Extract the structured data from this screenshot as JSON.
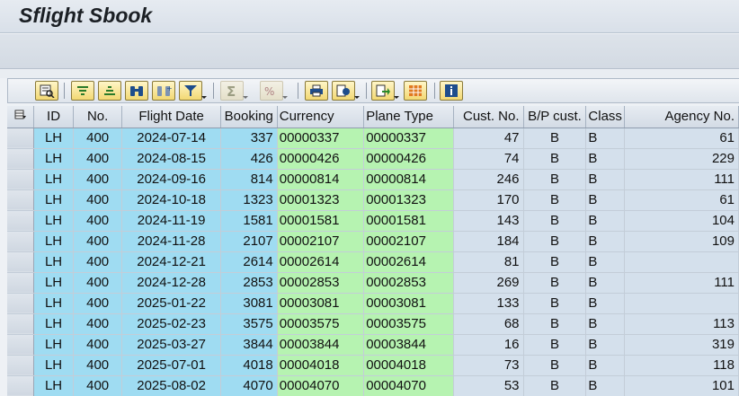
{
  "window": {
    "title": "Sflight Sbook"
  },
  "toolbar": {
    "buttons": [
      {
        "name": "details-button",
        "icon": "details-icon"
      },
      {
        "name": "sort-ascending-button",
        "icon": "sort-ascending-icon"
      },
      {
        "name": "sort-descending-button",
        "icon": "sort-descending-icon"
      },
      {
        "name": "find-button",
        "icon": "binoculars-icon"
      },
      {
        "name": "find-next-button",
        "icon": "find-next-icon"
      },
      {
        "name": "filter-button",
        "icon": "filter-icon"
      },
      {
        "name": "total-button",
        "icon": "sigma-icon"
      },
      {
        "name": "subtotal-button",
        "icon": "subtotal-icon"
      },
      {
        "name": "print-button",
        "icon": "printer-icon"
      },
      {
        "name": "views-button",
        "icon": "views-icon"
      },
      {
        "name": "export-button",
        "icon": "export-icon"
      },
      {
        "name": "layout-button",
        "icon": "layout-grid-icon"
      },
      {
        "name": "info-button",
        "icon": "info-icon"
      }
    ]
  },
  "grid": {
    "columns": [
      "ID",
      "No.",
      "Flight Date",
      "Booking",
      "Currency",
      "Plane Type",
      "Cust. No.",
      "B/P cust.",
      "Class",
      "Agency No."
    ],
    "rows": [
      [
        "LH",
        "400",
        "2024-07-14",
        "337",
        "00000337",
        "00000337",
        "47",
        "B",
        "B",
        "61"
      ],
      [
        "LH",
        "400",
        "2024-08-15",
        "426",
        "00000426",
        "00000426",
        "74",
        "B",
        "B",
        "229"
      ],
      [
        "LH",
        "400",
        "2024-09-16",
        "814",
        "00000814",
        "00000814",
        "246",
        "B",
        "B",
        "111"
      ],
      [
        "LH",
        "400",
        "2024-10-18",
        "1323",
        "00001323",
        "00001323",
        "170",
        "B",
        "B",
        "61"
      ],
      [
        "LH",
        "400",
        "2024-11-19",
        "1581",
        "00001581",
        "00001581",
        "143",
        "B",
        "B",
        "104"
      ],
      [
        "LH",
        "400",
        "2024-11-28",
        "2107",
        "00002107",
        "00002107",
        "184",
        "B",
        "B",
        "109"
      ],
      [
        "LH",
        "400",
        "2024-12-21",
        "2614",
        "00002614",
        "00002614",
        "81",
        "B",
        "B",
        ""
      ],
      [
        "LH",
        "400",
        "2024-12-28",
        "2853",
        "00002853",
        "00002853",
        "269",
        "B",
        "B",
        "111"
      ],
      [
        "LH",
        "400",
        "2025-01-22",
        "3081",
        "00003081",
        "00003081",
        "133",
        "B",
        "B",
        ""
      ],
      [
        "LH",
        "400",
        "2025-02-23",
        "3575",
        "00003575",
        "00003575",
        "68",
        "B",
        "B",
        "113"
      ],
      [
        "LH",
        "400",
        "2025-03-27",
        "3844",
        "00003844",
        "00003844",
        "16",
        "B",
        "B",
        "319"
      ],
      [
        "LH",
        "400",
        "2025-07-01",
        "4018",
        "00004018",
        "00004018",
        "73",
        "B",
        "B",
        "118"
      ],
      [
        "LH",
        "400",
        "2025-08-02",
        "4070",
        "00004070",
        "00004070",
        "53",
        "B",
        "B",
        "101"
      ]
    ]
  },
  "colors": {
    "key_column": "#9fdcf2",
    "text_column": "#b6f3b1",
    "plain_column": "#d4e0ec"
  }
}
